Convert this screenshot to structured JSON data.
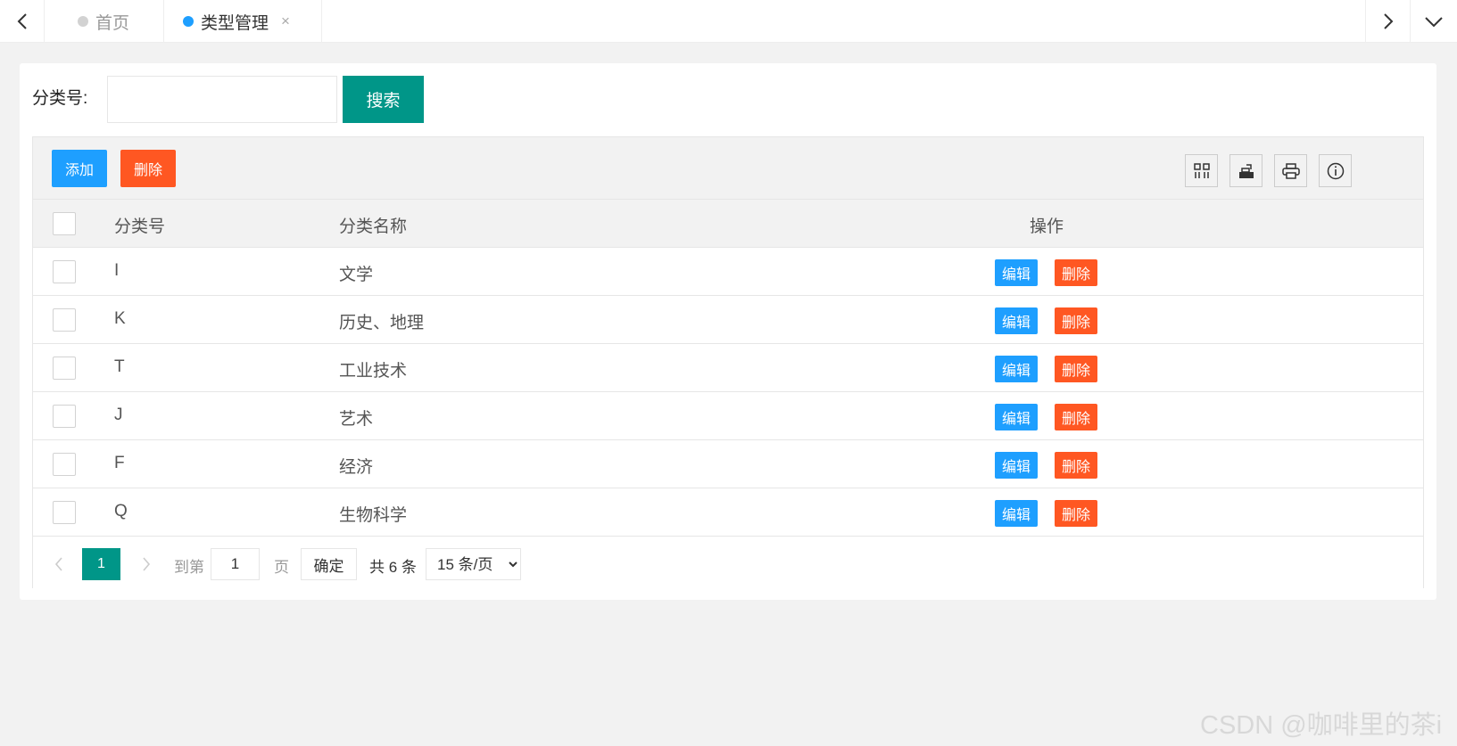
{
  "tabs": {
    "home": "首页",
    "type_management": "类型管理",
    "close": "×"
  },
  "search": {
    "label": "分类号:",
    "input_value": "",
    "button": "搜索"
  },
  "toolbar": {
    "add": "添加",
    "delete": "删除",
    "icons": [
      "columns-icon",
      "export-icon",
      "print-icon",
      "info-icon"
    ]
  },
  "table": {
    "headers": {
      "code": "分类号",
      "name": "分类名称",
      "actions": "操作"
    },
    "rows": [
      {
        "code": "I",
        "name": "文学"
      },
      {
        "code": "K",
        "name": "历史、地理"
      },
      {
        "code": "T",
        "name": "工业技术"
      },
      {
        "code": "J",
        "name": "艺术"
      },
      {
        "code": "F",
        "name": "经济"
      },
      {
        "code": "Q",
        "name": "生物科学"
      }
    ],
    "row_edit": "编辑",
    "row_delete": "删除"
  },
  "pagination": {
    "current_page": "1",
    "goto_prefix": "到第",
    "goto_value": "1",
    "goto_suffix": "页",
    "confirm": "确定",
    "total": "共 6 条",
    "page_size": "15 条/页"
  },
  "watermark": "CSDN @咖啡里的茶i",
  "colors": {
    "primary": "#009688",
    "blue": "#1e9fff",
    "danger": "#ff5722"
  }
}
